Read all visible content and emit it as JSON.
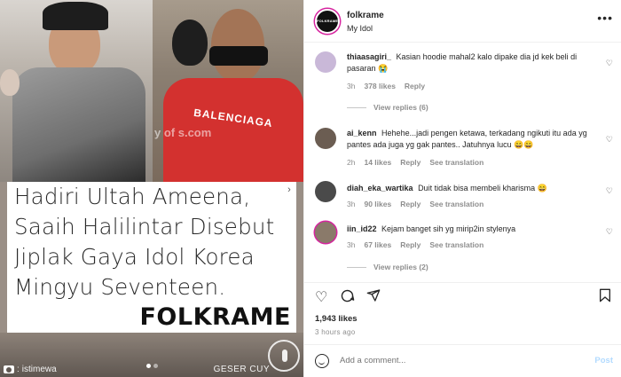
{
  "media": {
    "headline_lines": [
      "Hadiri Ultah Ameena,",
      "Saaih Halilintar Disebut",
      "Jiplak Gaya Idol Korea",
      "Mingyu Seventeen."
    ],
    "brand": "FOLKRAME",
    "credit": "istimewa",
    "swipe_hint": "GESER CUY",
    "hoodie_text": "BALENCIAGA",
    "faint_watermark": "y of s.com"
  },
  "header": {
    "avatar_text": "FOLKRAME",
    "username": "folkrame",
    "subtitle": "My Idol",
    "more": "•••"
  },
  "comments": [
    {
      "user": "thiaasagiri_",
      "text": "Kasian hoodie mahal2 kalo dipake dia jd kek beli di pasaran",
      "emoji": "😭",
      "time": "3h",
      "likes": "378 likes",
      "reply": "Reply",
      "translate": "",
      "view_replies": "View replies (6)",
      "avatar_color": "#c9b8d8"
    },
    {
      "user": "ai_kenn",
      "text": "Hehehe...jadi pengen ketawa, terkadang ngikuti itu ada yg pantes ada juga yg gak pantes.. Jatuhnya lucu",
      "emoji": "😄😄",
      "time": "2h",
      "likes": "14 likes",
      "reply": "Reply",
      "translate": "See translation",
      "view_replies": "",
      "avatar_color": "#6b5d52"
    },
    {
      "user": "diah_eka_wartika",
      "text": "Duit tidak bisa membeli kharisma",
      "emoji": "😄",
      "time": "3h",
      "likes": "90 likes",
      "reply": "Reply",
      "translate": "See translation",
      "view_replies": "",
      "avatar_color": "#4a4a4a"
    },
    {
      "user": "iin_id22",
      "text": "Kejam banget sih yg mirip2in stylenya",
      "emoji": "",
      "time": "3h",
      "likes": "67 likes",
      "reply": "Reply",
      "translate": "See translation",
      "view_replies": "View replies (2)",
      "avatar_color": "#8a7a6a"
    }
  ],
  "actions": {
    "likes": "1,943 likes",
    "time": "3 hours ago"
  },
  "add_comment": {
    "placeholder": "Add a comment...",
    "post": "Post"
  },
  "colors": {
    "accent_ring": "#d6249f",
    "post_disabled": "#b3dbff",
    "meta_grey": "#8e8e8e"
  }
}
